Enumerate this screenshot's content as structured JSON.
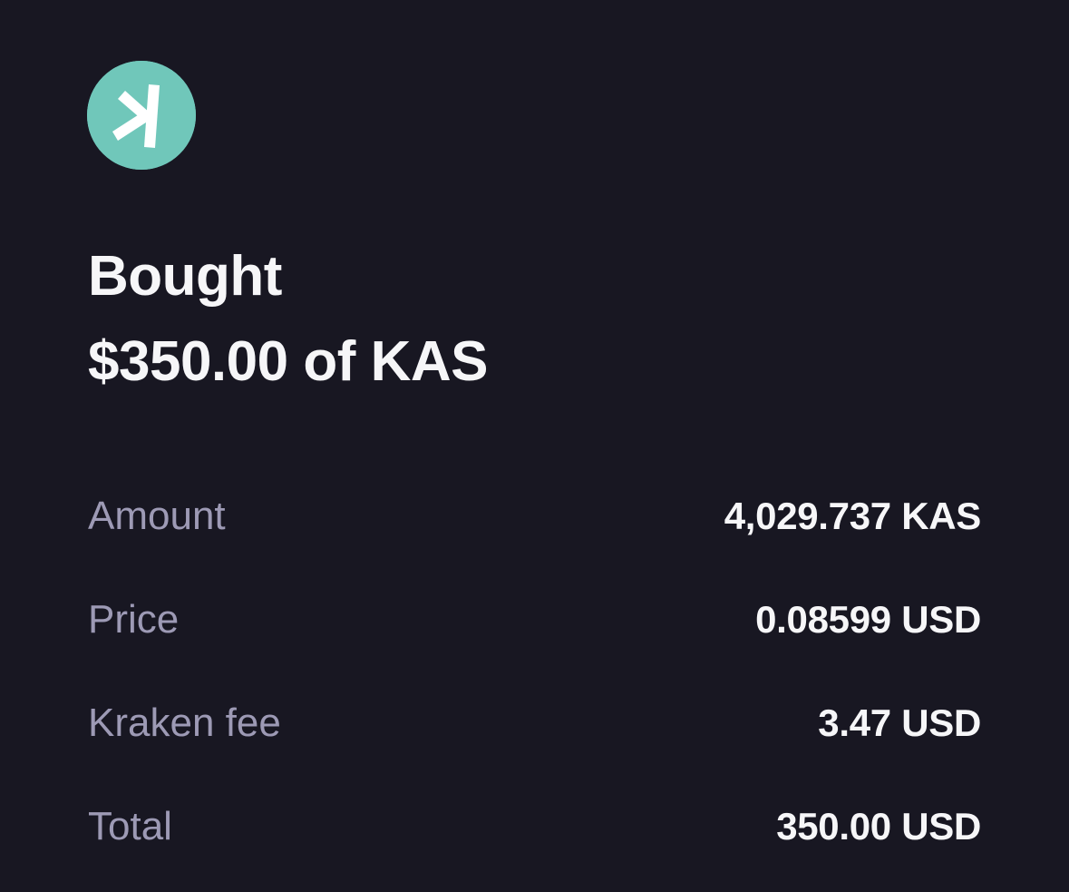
{
  "asset": {
    "icon": "kaspa-logo-icon",
    "color": "#70c7ba"
  },
  "heading": {
    "line1": "Bought",
    "line2": "$350.00 of KAS"
  },
  "details": [
    {
      "label": "Amount",
      "value": "4,029.737 KAS"
    },
    {
      "label": "Price",
      "value": "0.08599 USD"
    },
    {
      "label": "Kraken fee",
      "value": "3.47 USD"
    },
    {
      "label": "Total",
      "value": "350.00 USD"
    }
  ],
  "colors": {
    "background": "#181722",
    "label": "#9d9ab5",
    "value": "#f6f6f8"
  }
}
